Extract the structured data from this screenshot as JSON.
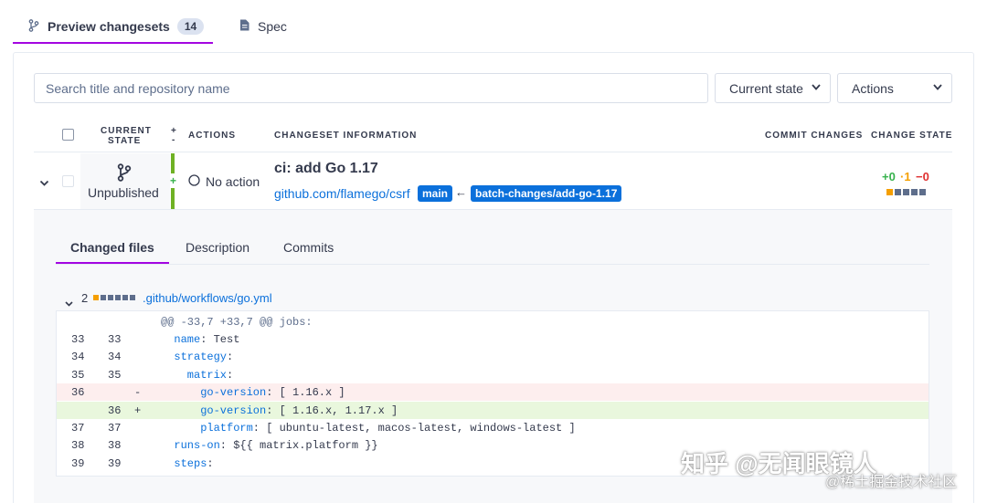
{
  "tabs": {
    "preview_label": "Preview changesets",
    "preview_count": "14",
    "spec_label": "Spec"
  },
  "filters": {
    "search_placeholder": "Search title and repository name",
    "state_select": "Current state",
    "actions_select": "Actions"
  },
  "table_headers": {
    "current_state_1": "CURRENT",
    "current_state_2": "STATE",
    "plus": "+",
    "minus": "-",
    "actions": "ACTIONS",
    "changeset_info": "CHANGESET INFORMATION",
    "commit_changes": "COMMIT CHANGES",
    "change_state": "CHANGE STATE"
  },
  "changeset": {
    "state_label": "Unpublished",
    "plus_marker": "+",
    "action_label": "No action",
    "title": "ci: add Go 1.17",
    "repo": "github.com/flamego/csrf",
    "base_branch": "main",
    "arrow": "←",
    "head_branch": "batch-changes/add-go-1.17",
    "diff_added": "+0",
    "diff_changed": "·1",
    "diff_deleted": "−0"
  },
  "subtabs": {
    "changed_files": "Changed files",
    "description": "Description",
    "commits": "Commits"
  },
  "file": {
    "change_count": "2",
    "path": ".github/workflows/go.yml"
  },
  "diff": {
    "hunk": "@@ -33,7 +33,7 @@ jobs:",
    "lines": [
      {
        "old": "33",
        "new": "33",
        "sign": "",
        "type": "ctx",
        "key": "name",
        "rest": ": Test",
        "indent": "  "
      },
      {
        "old": "34",
        "new": "34",
        "sign": "",
        "type": "ctx",
        "key": "strategy",
        "rest": ":",
        "indent": "  "
      },
      {
        "old": "35",
        "new": "35",
        "sign": "",
        "type": "ctx",
        "key": "matrix",
        "rest": ":",
        "indent": "    "
      },
      {
        "old": "36",
        "new": "",
        "sign": "-",
        "type": "del",
        "key": "go-version",
        "rest": ": [ 1.16.x ]",
        "indent": "      "
      },
      {
        "old": "",
        "new": "36",
        "sign": "+",
        "type": "add",
        "key": "go-version",
        "rest": ": [ 1.16.x, 1.17.x ]",
        "indent": "      "
      },
      {
        "old": "37",
        "new": "37",
        "sign": "",
        "type": "ctx",
        "key": "platform",
        "rest": ": [ ubuntu-latest, macos-latest, windows-latest ]",
        "indent": "      "
      },
      {
        "old": "38",
        "new": "38",
        "sign": "",
        "type": "ctx",
        "key": "runs-on",
        "rest": ": ${{ matrix.platform }}",
        "indent": "  "
      },
      {
        "old": "39",
        "new": "39",
        "sign": "",
        "type": "ctx",
        "key": "steps",
        "rest": ":",
        "indent": "  "
      }
    ]
  },
  "watermark": {
    "line1": "知乎 @无闻眼镜人",
    "line2": "@稀土掘金技术社区"
  },
  "colors": {
    "accent": "#a305e1",
    "link": "#0b70db",
    "added": "#37b24d",
    "changed": "#f59f00",
    "deleted": "#e03131"
  }
}
